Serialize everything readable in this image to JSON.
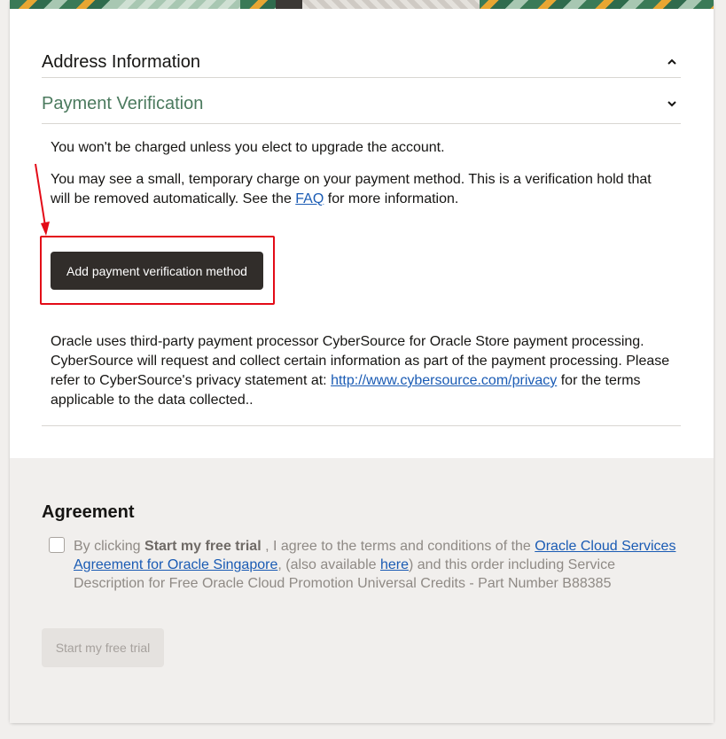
{
  "sections": {
    "address": {
      "title": "Address Information",
      "state": "expanded"
    },
    "payment": {
      "title": "Payment Verification",
      "accent_color": "#4b7a5e"
    }
  },
  "payment": {
    "no_charge_text": "You won't be charged unless you elect to upgrade the account.",
    "temp_charge_text_before": "You may see a small, temporary charge on your payment method. This is a verification hold that will be removed automatically. See the ",
    "faq_link": "FAQ",
    "temp_charge_text_after": " for more information.",
    "add_button": "Add payment verification method",
    "processor_text_before": "Oracle uses third-party payment processor CyberSource for Oracle Store payment processing. CyberSource will request and collect certain information as part of the payment processing. Please refer to CyberSource's privacy statement at: ",
    "privacy_link": "http://www.cybersource.com/privacy",
    "processor_text_after": " for the terms applicable to the data collected.."
  },
  "agreement": {
    "title": "Agreement",
    "text_1": "By clicking ",
    "text_bold": "Start my free trial",
    "text_2": " , I agree to the terms and conditions of the ",
    "agreement_link": "Oracle Cloud Services Agreement for Oracle Singapore",
    "text_3": ", (also available ",
    "here_link": "here",
    "text_4": ") and this order including Service Description for Free Oracle Cloud Promotion Universal Credits - Part Number B88385",
    "checked": false,
    "start_button": "Start my free trial"
  },
  "colors": {
    "highlight": "#e30b17",
    "link": "#1a5bb4",
    "dark_button": "#312d2a"
  }
}
